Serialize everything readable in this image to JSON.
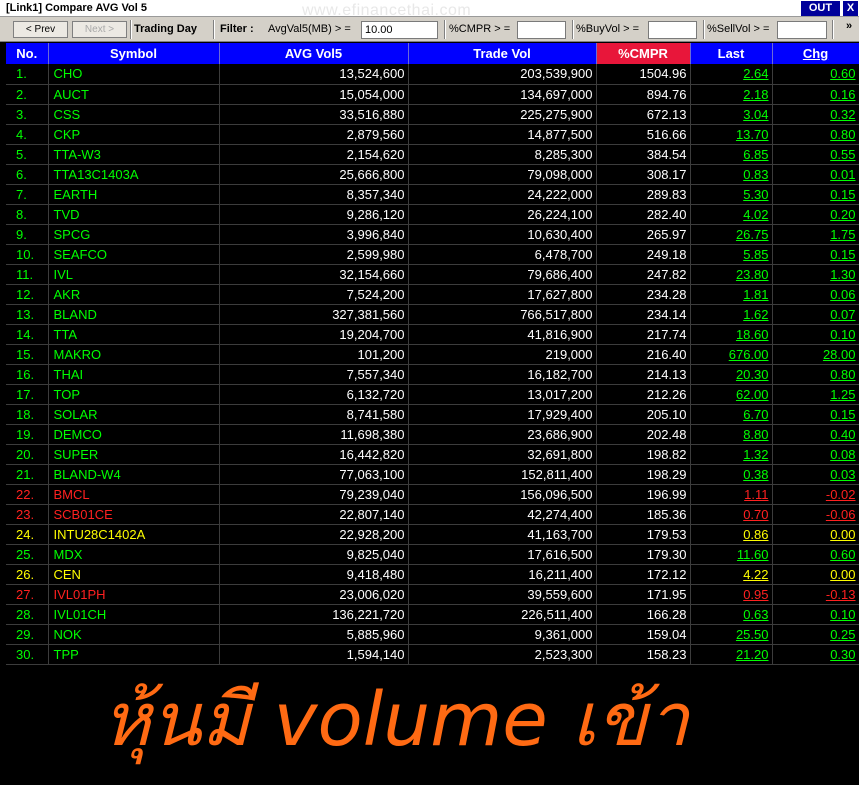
{
  "window": {
    "title": "[Link1] Compare AVG Vol 5",
    "watermark": "www.efinancethai.com",
    "out_label": "OUT",
    "close_label": "X"
  },
  "toolbar": {
    "prev_label": "< Prev",
    "next_label": "Next >",
    "trading_day_label": "Trading Day",
    "filter_label": "Filter :",
    "avgvol_label": "AvgVal5(MB) > =",
    "avgvol_value": "10.00",
    "cmpr_label": "%CMPR > =",
    "cmpr_value": "",
    "buyvol_label": "%BuyVol > =",
    "buyvol_value": "",
    "sellvol_label": "%SellVol > =",
    "sellvol_value": "",
    "more_label": "»"
  },
  "colors": {
    "up": "#00ff00",
    "down": "#ff2020",
    "unchanged": "#ffff00",
    "header_bg": "#0000ff",
    "cmpr_header_bg": "#e8163a",
    "caption": "#ff6a13"
  },
  "grid": {
    "columns": [
      "No.",
      "Symbol",
      "AVG Vol5",
      "Trade Vol",
      "%CMPR",
      "Last",
      "Chg"
    ],
    "rows": [
      {
        "no": "1.",
        "symbol": "CHO",
        "avg": "13,524,600",
        "trade": "203,539,900",
        "cmpr": "1504.96",
        "last": "2.64",
        "chg": "0.60",
        "color": "#00ff00"
      },
      {
        "no": "2.",
        "symbol": "AUCT",
        "avg": "15,054,000",
        "trade": "134,697,000",
        "cmpr": "894.76",
        "last": "2.18",
        "chg": "0.16",
        "color": "#00ff00"
      },
      {
        "no": "3.",
        "symbol": "CSS",
        "avg": "33,516,880",
        "trade": "225,275,900",
        "cmpr": "672.13",
        "last": "3.04",
        "chg": "0.32",
        "color": "#00ff00"
      },
      {
        "no": "4.",
        "symbol": "CKP",
        "avg": "2,879,560",
        "trade": "14,877,500",
        "cmpr": "516.66",
        "last": "13.70",
        "chg": "0.80",
        "color": "#00ff00"
      },
      {
        "no": "5.",
        "symbol": "TTA-W3",
        "avg": "2,154,620",
        "trade": "8,285,300",
        "cmpr": "384.54",
        "last": "6.85",
        "chg": "0.55",
        "color": "#00ff00"
      },
      {
        "no": "6.",
        "symbol": "TTA13C1403A",
        "avg": "25,666,800",
        "trade": "79,098,000",
        "cmpr": "308.17",
        "last": "0.83",
        "chg": "0.01",
        "color": "#00ff00"
      },
      {
        "no": "7.",
        "symbol": "EARTH",
        "avg": "8,357,340",
        "trade": "24,222,000",
        "cmpr": "289.83",
        "last": "5.30",
        "chg": "0.15",
        "color": "#00ff00"
      },
      {
        "no": "8.",
        "symbol": "TVD",
        "avg": "9,286,120",
        "trade": "26,224,100",
        "cmpr": "282.40",
        "last": "4.02",
        "chg": "0.20",
        "color": "#00ff00"
      },
      {
        "no": "9.",
        "symbol": "SPCG",
        "avg": "3,996,840",
        "trade": "10,630,400",
        "cmpr": "265.97",
        "last": "26.75",
        "chg": "1.75",
        "color": "#00ff00"
      },
      {
        "no": "10.",
        "symbol": "SEAFCO",
        "avg": "2,599,980",
        "trade": "6,478,700",
        "cmpr": "249.18",
        "last": "5.85",
        "chg": "0.15",
        "color": "#00ff00"
      },
      {
        "no": "11.",
        "symbol": "IVL",
        "avg": "32,154,660",
        "trade": "79,686,400",
        "cmpr": "247.82",
        "last": "23.80",
        "chg": "1.30",
        "color": "#00ff00"
      },
      {
        "no": "12.",
        "symbol": "AKR",
        "avg": "7,524,200",
        "trade": "17,627,800",
        "cmpr": "234.28",
        "last": "1.81",
        "chg": "0.06",
        "color": "#00ff00"
      },
      {
        "no": "13.",
        "symbol": "BLAND",
        "avg": "327,381,560",
        "trade": "766,517,800",
        "cmpr": "234.14",
        "last": "1.62",
        "chg": "0.07",
        "color": "#00ff00"
      },
      {
        "no": "14.",
        "symbol": "TTA",
        "avg": "19,204,700",
        "trade": "41,816,900",
        "cmpr": "217.74",
        "last": "18.60",
        "chg": "0.10",
        "color": "#00ff00"
      },
      {
        "no": "15.",
        "symbol": "MAKRO",
        "avg": "101,200",
        "trade": "219,000",
        "cmpr": "216.40",
        "last": "676.00",
        "chg": "28.00",
        "color": "#00ff00"
      },
      {
        "no": "16.",
        "symbol": "THAI",
        "avg": "7,557,340",
        "trade": "16,182,700",
        "cmpr": "214.13",
        "last": "20.30",
        "chg": "0.80",
        "color": "#00ff00"
      },
      {
        "no": "17.",
        "symbol": "TOP",
        "avg": "6,132,720",
        "trade": "13,017,200",
        "cmpr": "212.26",
        "last": "62.00",
        "chg": "1.25",
        "color": "#00ff00"
      },
      {
        "no": "18.",
        "symbol": "SOLAR",
        "avg": "8,741,580",
        "trade": "17,929,400",
        "cmpr": "205.10",
        "last": "6.70",
        "chg": "0.15",
        "color": "#00ff00"
      },
      {
        "no": "19.",
        "symbol": "DEMCO",
        "avg": "11,698,380",
        "trade": "23,686,900",
        "cmpr": "202.48",
        "last": "8.80",
        "chg": "0.40",
        "color": "#00ff00"
      },
      {
        "no": "20.",
        "symbol": "SUPER",
        "avg": "16,442,820",
        "trade": "32,691,800",
        "cmpr": "198.82",
        "last": "1.32",
        "chg": "0.08",
        "color": "#00ff00"
      },
      {
        "no": "21.",
        "symbol": "BLAND-W4",
        "avg": "77,063,100",
        "trade": "152,811,400",
        "cmpr": "198.29",
        "last": "0.38",
        "chg": "0.03",
        "color": "#00ff00"
      },
      {
        "no": "22.",
        "symbol": "BMCL",
        "avg": "79,239,040",
        "trade": "156,096,500",
        "cmpr": "196.99",
        "last": "1.11",
        "chg": "-0.02",
        "color": "#ff2020"
      },
      {
        "no": "23.",
        "symbol": "SCB01CE",
        "avg": "22,807,140",
        "trade": "42,274,400",
        "cmpr": "185.36",
        "last": "0.70",
        "chg": "-0.06",
        "color": "#ff2020"
      },
      {
        "no": "24.",
        "symbol": "INTU28C1402A",
        "avg": "22,928,200",
        "trade": "41,163,700",
        "cmpr": "179.53",
        "last": "0.86",
        "chg": "0.00",
        "color": "#ffff00"
      },
      {
        "no": "25.",
        "symbol": "MDX",
        "avg": "9,825,040",
        "trade": "17,616,500",
        "cmpr": "179.30",
        "last": "11.60",
        "chg": "0.60",
        "color": "#00ff00"
      },
      {
        "no": "26.",
        "symbol": "CEN",
        "avg": "9,418,480",
        "trade": "16,211,400",
        "cmpr": "172.12",
        "last": "4.22",
        "chg": "0.00",
        "color": "#ffff00"
      },
      {
        "no": "27.",
        "symbol": "IVL01PH",
        "avg": "23,006,020",
        "trade": "39,559,600",
        "cmpr": "171.95",
        "last": "0.95",
        "chg": "-0.13",
        "color": "#ff2020"
      },
      {
        "no": "28.",
        "symbol": "IVL01CH",
        "avg": "136,221,720",
        "trade": "226,511,400",
        "cmpr": "166.28",
        "last": "0.63",
        "chg": "0.10",
        "color": "#00ff00"
      },
      {
        "no": "29.",
        "symbol": "NOK",
        "avg": "5,885,960",
        "trade": "9,361,000",
        "cmpr": "159.04",
        "last": "25.50",
        "chg": "0.25",
        "color": "#00ff00"
      },
      {
        "no": "30.",
        "symbol": "TPP",
        "avg": "1,594,140",
        "trade": "2,523,300",
        "cmpr": "158.23",
        "last": "21.20",
        "chg": "0.30",
        "color": "#00ff00"
      }
    ]
  },
  "caption": "หุ้นมี volume เข้า"
}
